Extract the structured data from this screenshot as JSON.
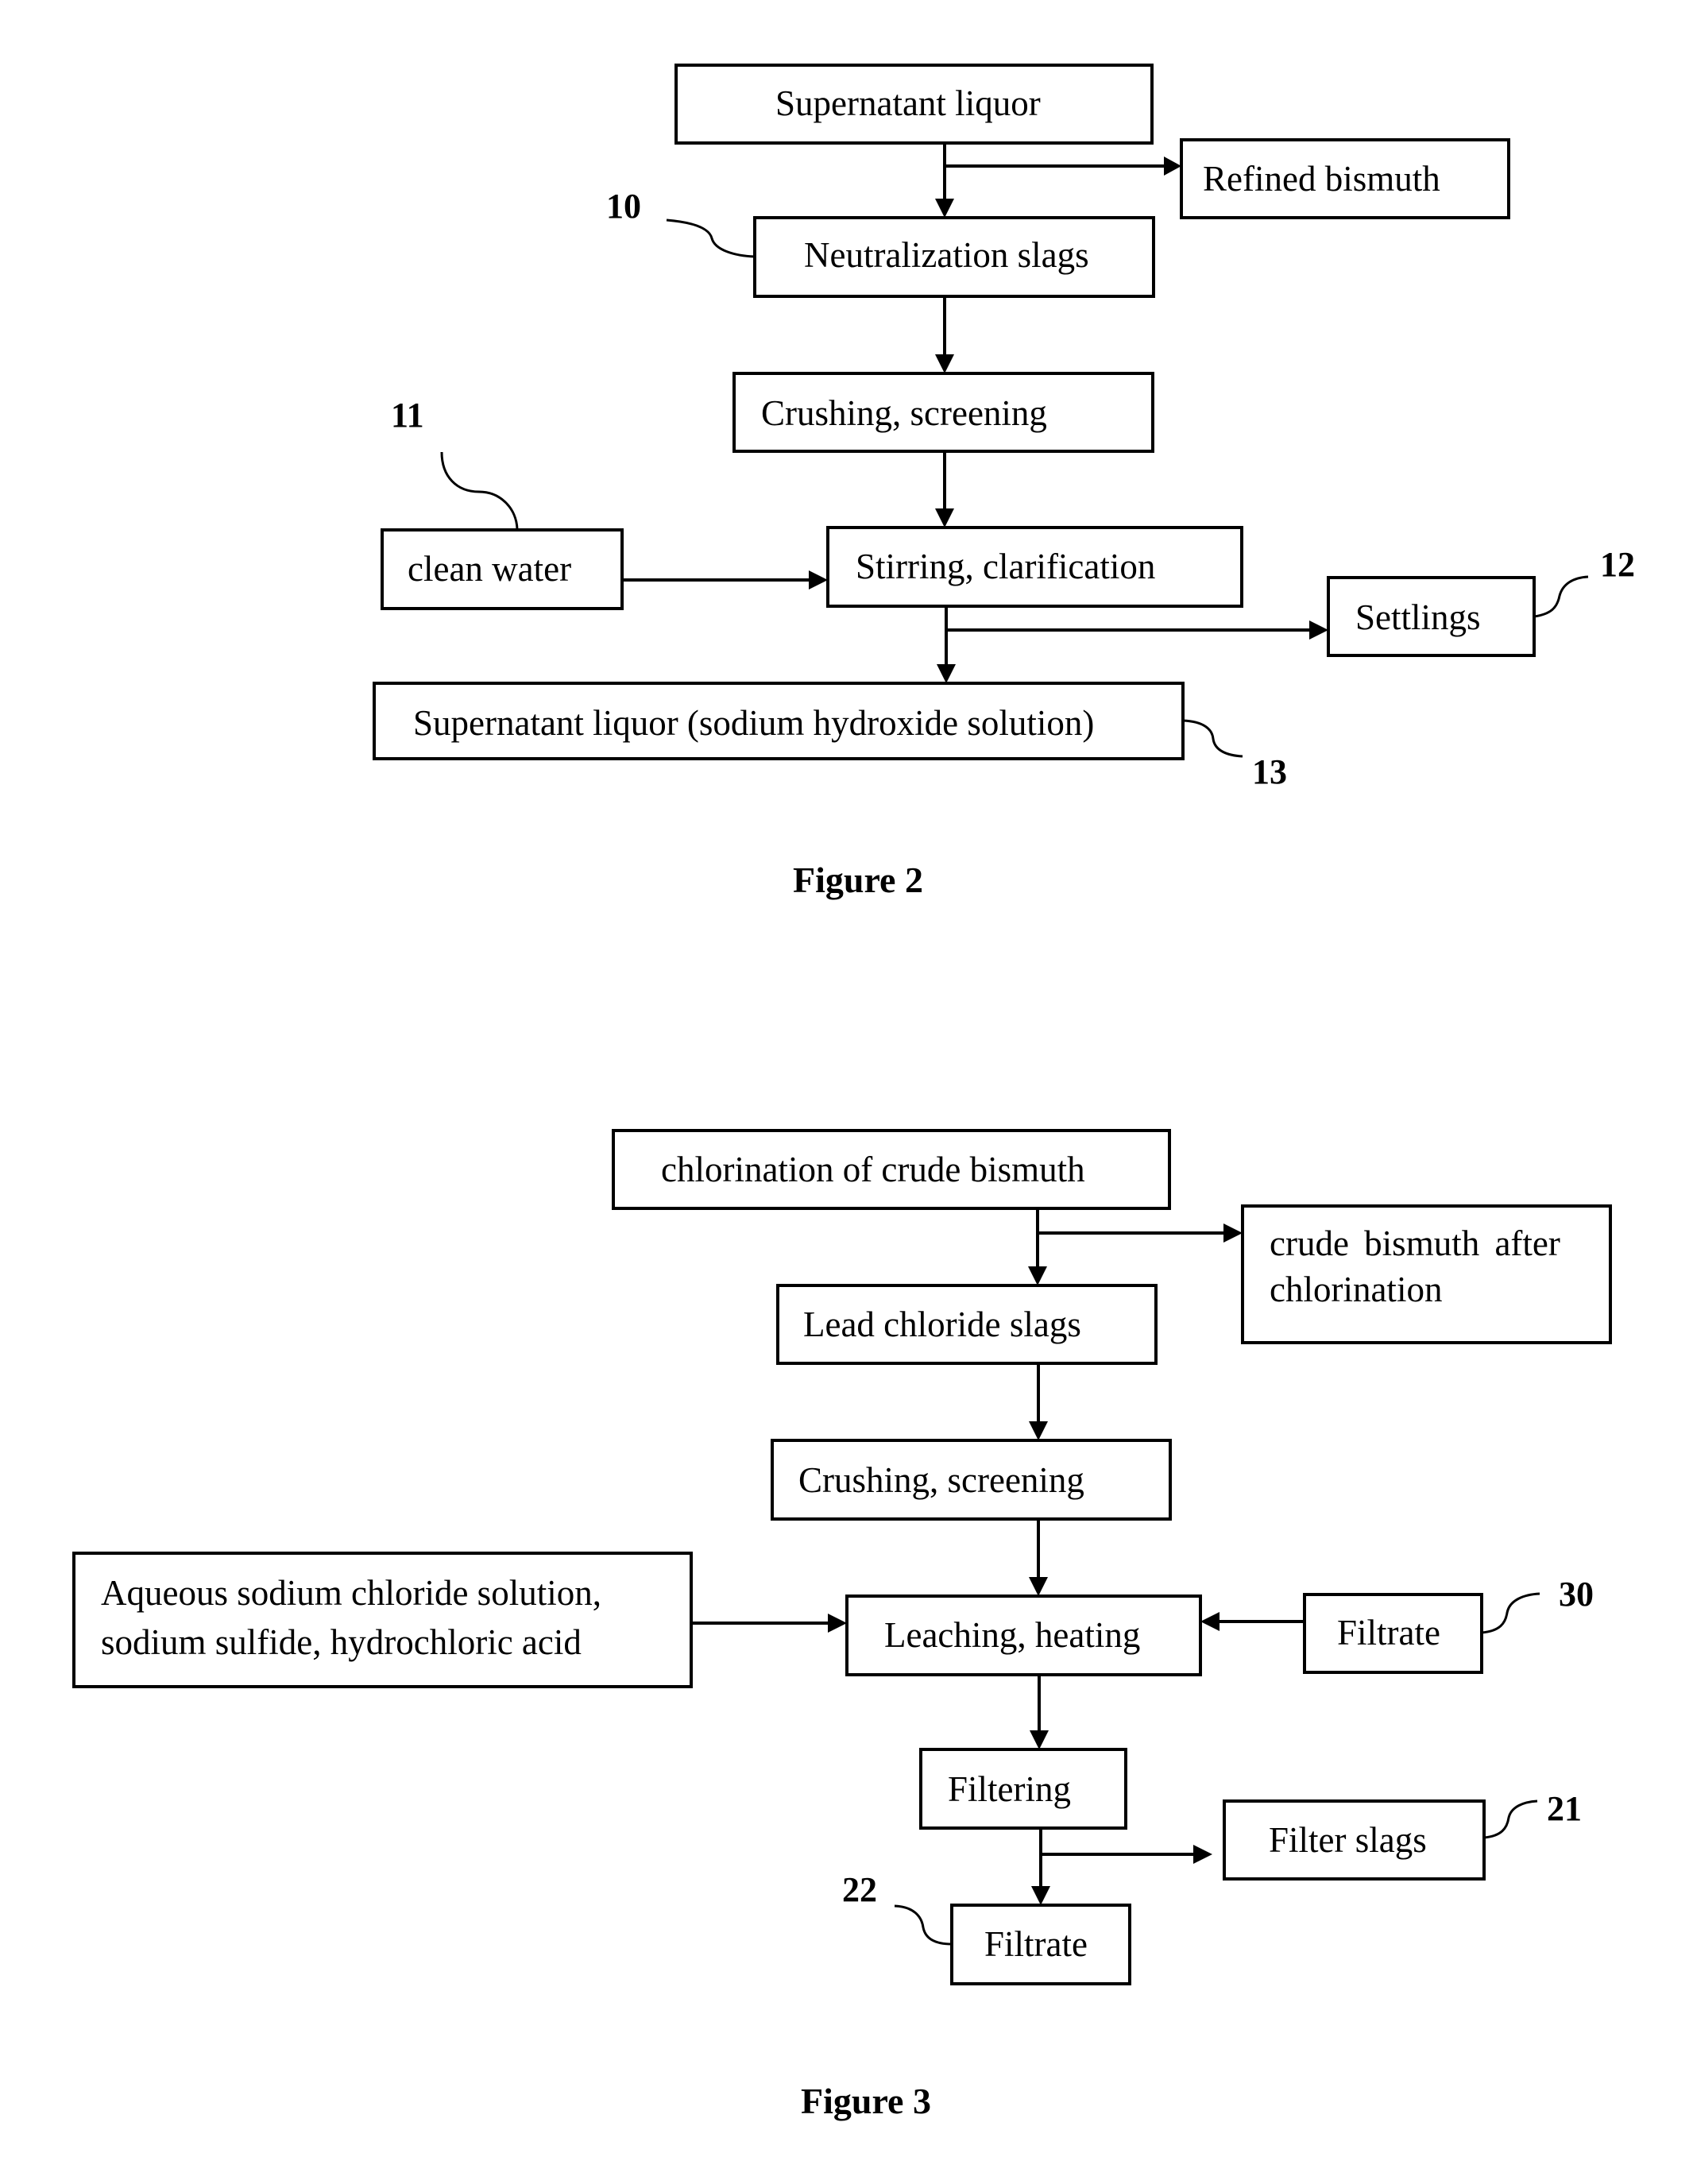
{
  "figure2": {
    "caption": "Figure 2",
    "nodes": {
      "supernatant_top": "Supernatant liquor",
      "refined_bismuth": "Refined bismuth",
      "neutralization_slags": "Neutralization slags",
      "crushing_screening": "Crushing, screening",
      "clean_water": "clean water",
      "stirring_clarification": "Stirring, clarification",
      "settlings": "Settlings",
      "supernatant_bottom": "Supernatant liquor (sodium hydroxide solution)"
    },
    "refs": {
      "neutralization_slags": "10",
      "clean_water": "11",
      "settlings": "12",
      "supernatant_bottom": "13"
    }
  },
  "figure3": {
    "caption": "Figure 3",
    "nodes": {
      "chlorination": "chlorination of crude bismuth",
      "crude_after_line1": "crude bismuth after",
      "crude_after_line2": "chlorination",
      "lead_chloride_slags": "Lead chloride slags",
      "crushing_screening": "Crushing, screening",
      "reagents_line1": "Aqueous sodium chloride solution,",
      "reagents_line2": "sodium sulfide, hydrochloric acid",
      "leaching_heating": "Leaching, heating",
      "filtrate_recycle": "Filtrate",
      "filtering": "Filtering",
      "filter_slags": "Filter slags",
      "filtrate_out": "Filtrate"
    },
    "refs": {
      "filtrate_recycle": "30",
      "filter_slags": "21",
      "filtrate_out": "22"
    }
  }
}
